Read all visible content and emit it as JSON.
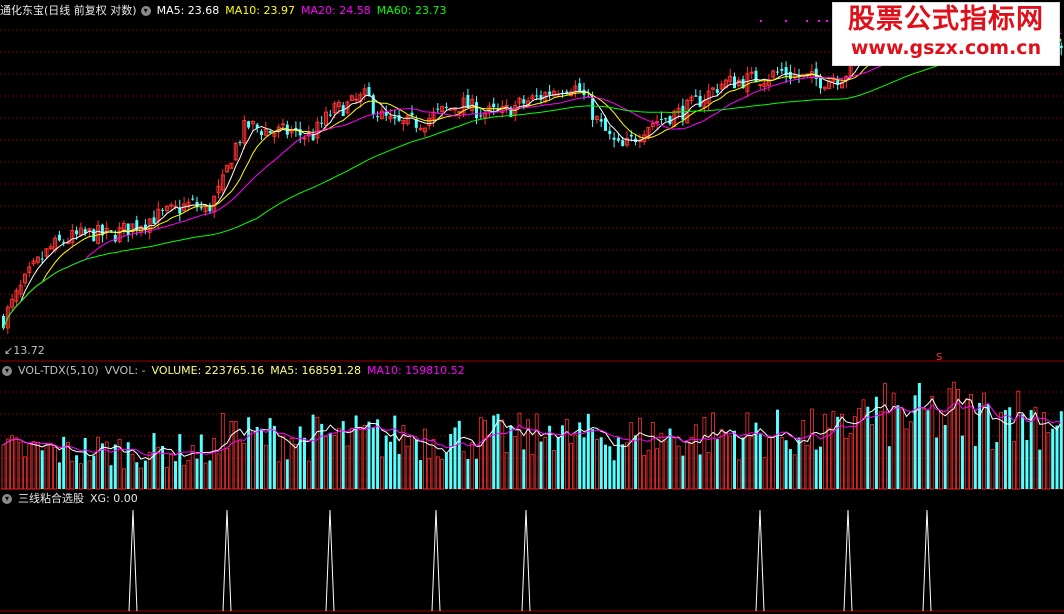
{
  "stock": {
    "name": "通化东宝",
    "period_label": "(日线 前复权 对数)"
  },
  "price_panel": {
    "indicators": [
      {
        "label": "MA5: 23.68",
        "color": "#ffffff"
      },
      {
        "label": "MA10: 23.97",
        "color": "#ffff00"
      },
      {
        "label": "MA20: 24.58",
        "color": "#ff00ff"
      },
      {
        "label": "MA60: 23.73",
        "color": "#00ff00"
      }
    ],
    "low_marker": "13.72",
    "signal_marker": "S"
  },
  "volume_panel": {
    "title": "VOL-TDX(5,10)",
    "indicators": [
      {
        "label": "VVOL: -",
        "color": "#c0c0c0"
      },
      {
        "label": "VOLUME: 223765.16",
        "color": "#c0c0c0"
      },
      {
        "label": "MA5: 168591.28",
        "color": "#c0c0c0"
      },
      {
        "label": "MA10: 159810.52",
        "color": "#ff00ff"
      }
    ]
  },
  "signal_panel": {
    "title": "三线粘合选股",
    "value_label": "XG: 0.00"
  },
  "watermark": {
    "line1": "股票公式指标网",
    "line2": "www.gszx.com.cn"
  },
  "colors": {
    "up": "#ff3232",
    "down": "#54ffff",
    "ma5": "#ffffff",
    "ma10": "#ffff00",
    "ma20": "#ff00ff",
    "ma60": "#00ff00",
    "grid": "#6e0000"
  },
  "chart_data": [
    {
      "type": "candlestick",
      "title": "通化东宝",
      "ylim": [
        13.0,
        30.5
      ],
      "close_trend": [
        [
          0,
          14.0
        ],
        [
          12,
          14.8
        ],
        [
          30,
          16.0
        ],
        [
          50,
          17.0
        ],
        [
          70,
          17.4
        ],
        [
          90,
          17.6
        ],
        [
          110,
          17.5
        ],
        [
          130,
          17.9
        ],
        [
          150,
          18.3
        ],
        [
          170,
          18.6
        ],
        [
          190,
          19.0
        ],
        [
          205,
          18.6
        ],
        [
          220,
          19.8
        ],
        [
          232,
          21.8
        ],
        [
          245,
          23.2
        ],
        [
          270,
          22.8
        ],
        [
          290,
          22.8
        ],
        [
          310,
          22.5
        ],
        [
          330,
          24.0
        ],
        [
          350,
          24.5
        ],
        [
          365,
          25.0
        ],
        [
          378,
          23.8
        ],
        [
          395,
          23.2
        ],
        [
          420,
          23.4
        ],
        [
          440,
          24.0
        ],
        [
          460,
          24.5
        ],
        [
          480,
          24.0
        ],
        [
          500,
          23.9
        ],
        [
          520,
          24.5
        ],
        [
          540,
          25.0
        ],
        [
          555,
          25.5
        ],
        [
          570,
          25.7
        ],
        [
          580,
          25.2
        ],
        [
          595,
          23.5
        ],
        [
          610,
          22.3
        ],
        [
          620,
          21.8
        ],
        [
          632,
          22.4
        ],
        [
          645,
          23.2
        ],
        [
          660,
          23.6
        ],
        [
          680,
          24.0
        ],
        [
          700,
          24.8
        ],
        [
          720,
          25.8
        ],
        [
          740,
          26.0
        ],
        [
          760,
          26.2
        ],
        [
          780,
          26.6
        ],
        [
          800,
          26.2
        ],
        [
          820,
          26.0
        ],
        [
          840,
          26.3
        ],
        [
          850,
          26.8
        ],
        [
          860,
          28.6
        ],
        [
          880,
          29.3
        ],
        [
          900,
          29.5
        ],
        [
          920,
          29.6
        ],
        [
          940,
          29.9
        ],
        [
          960,
          30.2
        ],
        [
          980,
          29.8
        ],
        [
          1000,
          30.0
        ],
        [
          1020,
          29.5
        ],
        [
          1035,
          28.8
        ],
        [
          1050,
          28.6
        ],
        [
          1060,
          28.8
        ]
      ],
      "ma_lines": [
        {
          "name": "MA5",
          "value": 23.68
        },
        {
          "name": "MA10",
          "value": 23.97
        },
        {
          "name": "MA20",
          "value": 24.58
        },
        {
          "name": "MA60",
          "value": 23.73
        }
      ],
      "grid": true
    },
    {
      "type": "bar",
      "title": "VOL-TDX(5,10)",
      "last_volume": 223765.16,
      "ma5": 168591.28,
      "ma10": 159810.52
    },
    {
      "type": "line",
      "title": "三线粘合选股",
      "series": [
        {
          "name": "XG",
          "values_nonzero_at": [
            133,
            227,
            330,
            436,
            526,
            760,
            848,
            927
          ]
        }
      ],
      "ylim": [
        0,
        1
      ]
    }
  ]
}
